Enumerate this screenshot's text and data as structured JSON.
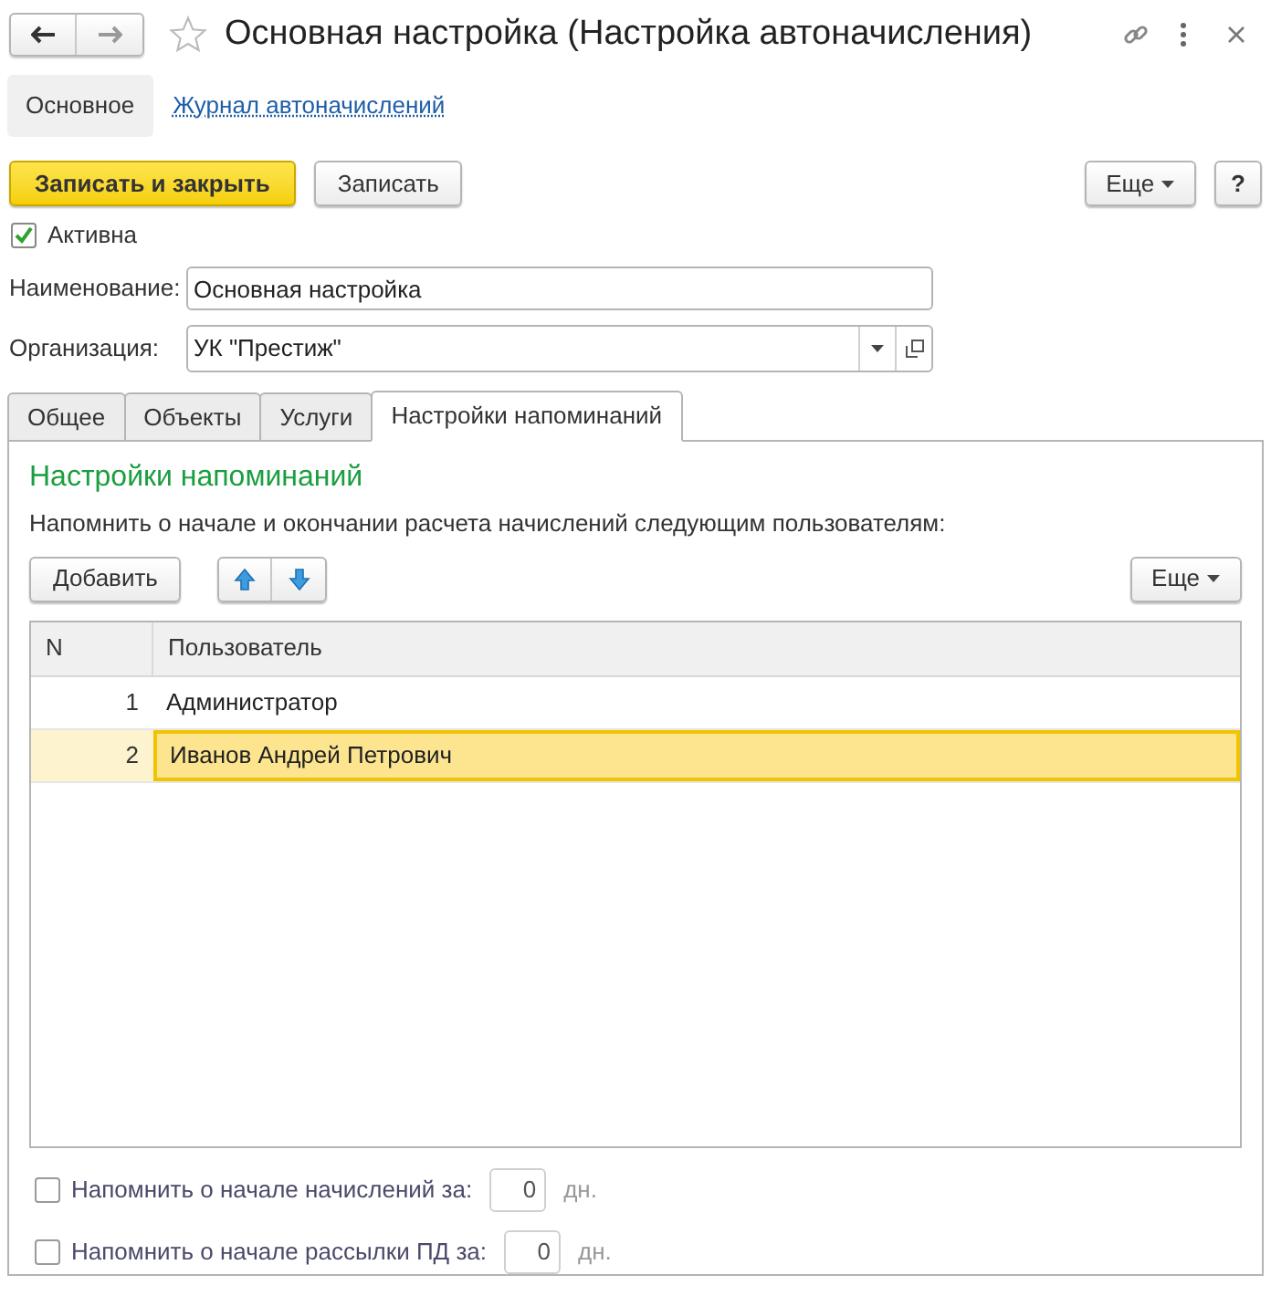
{
  "window": {
    "title": "Основная настройка (Настройка автоначисления)"
  },
  "nav": [
    {
      "label": "Основное",
      "selected": true
    },
    {
      "label": "Журнал автоначислений",
      "selected": false
    }
  ],
  "toolbar": {
    "primary": "Записать и закрыть",
    "save": "Записать",
    "more": "Еще",
    "help": "?"
  },
  "active": {
    "label": "Активна",
    "checked": true
  },
  "fields": [
    {
      "label": "Наименование:",
      "value": "Основная настройка",
      "kind": "text"
    },
    {
      "label": "Организация:",
      "value": "УК \"Престиж\"",
      "kind": "select"
    }
  ],
  "tabs": [
    {
      "label": "Общее",
      "selected": false
    },
    {
      "label": "Объекты",
      "selected": false
    },
    {
      "label": "Услуги",
      "selected": false
    },
    {
      "label": "Настройки напоминаний",
      "selected": true
    }
  ],
  "panel": {
    "heading": "Настройки напоминаний",
    "description": "Напомнить о начале и окончании расчета начислений следующим пользователям:",
    "add": "Добавить",
    "more": "Еще"
  },
  "table": {
    "columns": [
      "N",
      "Пользователь"
    ],
    "rows": [
      {
        "n": "1",
        "user": "Администратор",
        "selected": false
      },
      {
        "n": "2",
        "user": "Иванов Андрей Петрович",
        "selected": true
      }
    ]
  },
  "reminders": [
    {
      "label": "Напомнить о начале начислений за:",
      "checked": false,
      "value": "0",
      "unit": "дн."
    },
    {
      "label": "Напомнить о начале рассылки ПД за:",
      "checked": false,
      "value": "0",
      "unit": "дн."
    }
  ]
}
